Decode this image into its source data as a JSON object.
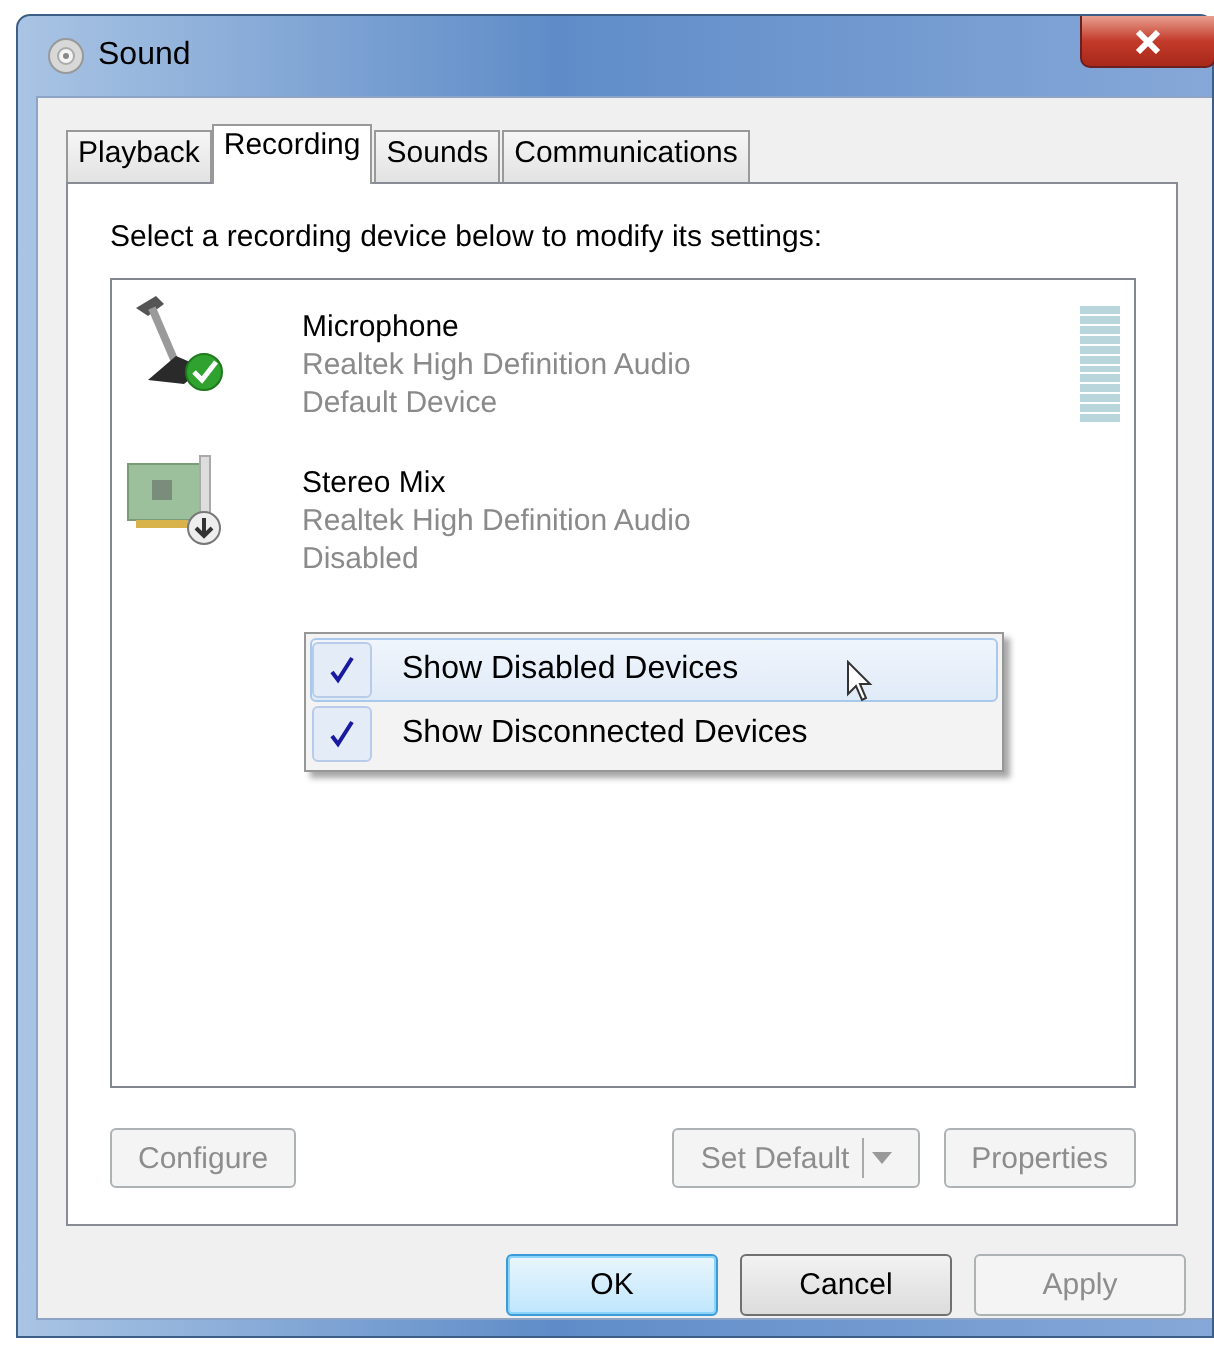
{
  "window": {
    "title": "Sound"
  },
  "tabs": [
    {
      "label": "Playback",
      "selected": false
    },
    {
      "label": "Recording",
      "selected": true
    },
    {
      "label": "Sounds",
      "selected": false
    },
    {
      "label": "Communications",
      "selected": false
    }
  ],
  "instruction": "Select a recording device below to modify its settings:",
  "devices": [
    {
      "kind": "microphone",
      "name": "Microphone",
      "driver": "Realtek High Definition Audio",
      "status": "Default Device",
      "default": true,
      "disabled": false,
      "meter": true
    },
    {
      "kind": "sound-card",
      "name": "Stereo Mix",
      "driver": "Realtek High Definition Audio",
      "status": "Disabled",
      "default": false,
      "disabled": true
    }
  ],
  "context_menu": [
    {
      "label": "Show Disabled Devices",
      "checked": true,
      "selected": true
    },
    {
      "label": "Show Disconnected Devices",
      "checked": true,
      "selected": false
    }
  ],
  "panel_buttons": [
    {
      "label": "Configure",
      "disabled": true,
      "kind": "plain"
    },
    {
      "label": "Set Default",
      "disabled": true,
      "kind": "split"
    },
    {
      "label": "Properties",
      "disabled": true,
      "kind": "plain"
    }
  ],
  "dialog_buttons": [
    {
      "label": "OK",
      "default": true,
      "disabled": false
    },
    {
      "label": "Cancel",
      "default": false,
      "disabled": false
    },
    {
      "label": "Apply",
      "default": false,
      "disabled": true
    }
  ]
}
